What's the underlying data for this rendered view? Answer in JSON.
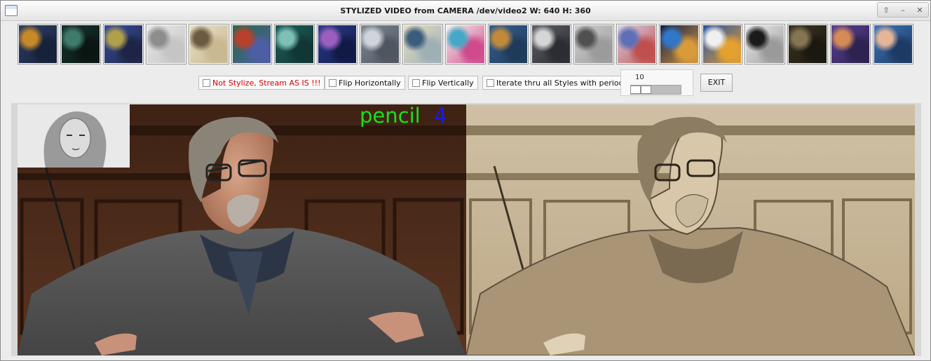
{
  "window": {
    "title": "STYLIZED VIDEO from CAMERA /dev/video2   W: 640  H: 360",
    "controls": {
      "up": "⇧",
      "minimize": "–",
      "close": "✕"
    }
  },
  "thumbnails": [
    {
      "name": "thumb-starry-night",
      "colors": [
        "#2d3f63",
        "#c78a28",
        "#16213a"
      ]
    },
    {
      "name": "thumb-dark-landscape",
      "colors": [
        "#15332e",
        "#3f7b6c",
        "#0b1613"
      ]
    },
    {
      "name": "thumb-blue-mosaic",
      "colors": [
        "#3a4f9c",
        "#b0a04a",
        "#1d2445"
      ]
    },
    {
      "name": "thumb-pencil-portrait",
      "colors": [
        "#e8e8e8",
        "#8d8d8d",
        "#c5c5c5"
      ]
    },
    {
      "name": "thumb-portrait-cream",
      "colors": [
        "#e8e0c8",
        "#6c5b40",
        "#c9b890"
      ]
    },
    {
      "name": "thumb-green-mosaic",
      "colors": [
        "#2a6a45",
        "#b7412d",
        "#4d5ea3"
      ]
    },
    {
      "name": "thumb-frida",
      "colors": [
        "#1c5e5a",
        "#7ec0b5",
        "#123634"
      ]
    },
    {
      "name": "thumb-galaxy",
      "colors": [
        "#2a3c8f",
        "#9c5fc0",
        "#111a45"
      ]
    },
    {
      "name": "thumb-gray-sketch",
      "colors": [
        "#7d8793",
        "#cfd5db",
        "#4e5660"
      ]
    },
    {
      "name": "thumb-great-wave",
      "colors": [
        "#e6ddc3",
        "#3b5c7a",
        "#9fb0b4"
      ]
    },
    {
      "name": "thumb-color-leaves",
      "colors": [
        "#f4f4ee",
        "#46a7c7",
        "#cf4b8c"
      ]
    },
    {
      "name": "thumb-scream",
      "colors": [
        "#365f8f",
        "#c08a3a",
        "#203b5a"
      ]
    },
    {
      "name": "thumb-cubist-gray",
      "colors": [
        "#5c5f66",
        "#d6d6d6",
        "#2b2d33"
      ]
    },
    {
      "name": "thumb-escher",
      "colors": [
        "#cfcfcf",
        "#505050",
        "#9b9b9b"
      ]
    },
    {
      "name": "thumb-pointillism",
      "colors": [
        "#d8d4e8",
        "#5e6fb5",
        "#c0504f"
      ]
    },
    {
      "name": "thumb-night-rain",
      "colors": [
        "#101c4a",
        "#2f78c8",
        "#d99a3a"
      ]
    },
    {
      "name": "thumb-blue-circles",
      "colors": [
        "#2550a8",
        "#f0f0f0",
        "#e3a12f"
      ]
    },
    {
      "name": "thumb-pollock",
      "colors": [
        "#efefef",
        "#1b1b1b",
        "#9a9a9a"
      ]
    },
    {
      "name": "thumb-dark-figure",
      "colors": [
        "#3a3423",
        "#857552",
        "#1b1810"
      ]
    },
    {
      "name": "thumb-purple-head",
      "colors": [
        "#5a3f95",
        "#d48b55",
        "#2d2250"
      ]
    },
    {
      "name": "thumb-picasso",
      "colors": [
        "#3f74b5",
        "#e5b59a",
        "#1d3a64"
      ]
    }
  ],
  "controls": {
    "not_stylize": "Not Stylize, Stream AS IS !!!",
    "flip_horizontally": "Flip Horizontally",
    "flip_vertically": "Flip Vertically",
    "iterate_label": "Iterate thru all Styles with period:",
    "period_value": "10",
    "exit_label": "EXIT",
    "accent_red": "#d00000"
  },
  "video": {
    "style_name": "pencil",
    "style_index": "4",
    "style_color": "#18e21a",
    "index_color": "#1a1ae8"
  }
}
